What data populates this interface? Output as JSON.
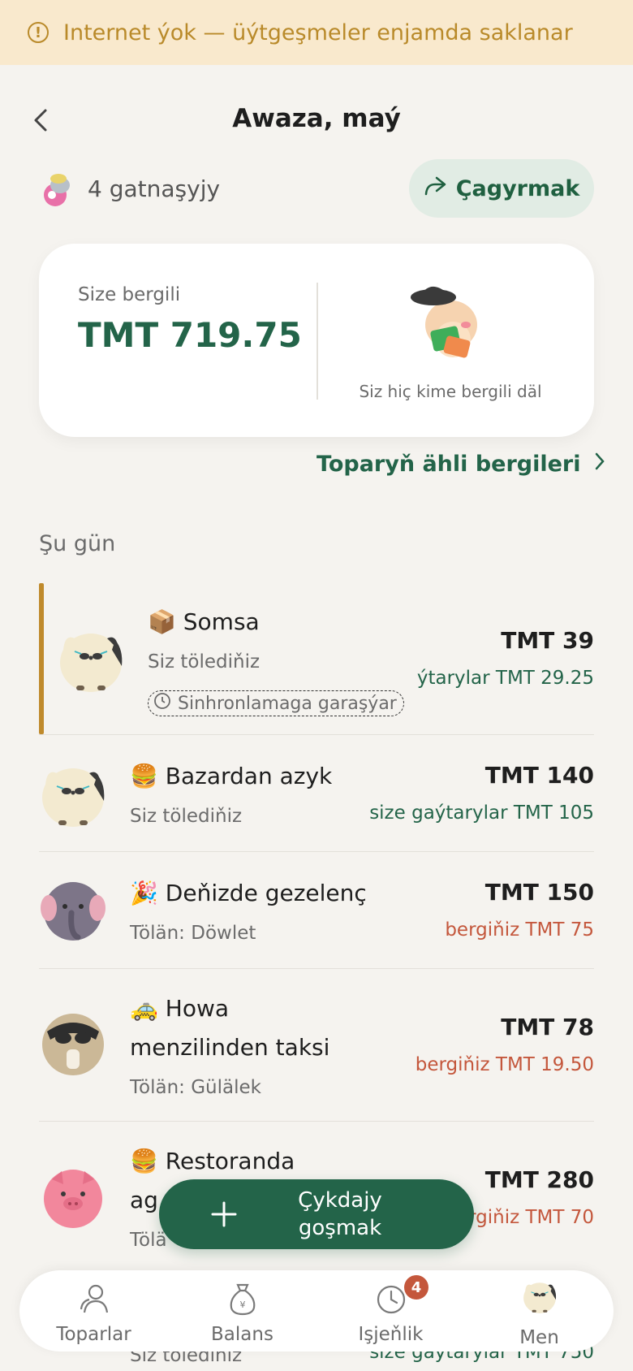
{
  "banner": {
    "text": "Internet ýok — üýtgeşmeler enjamda saklanar",
    "icon": "warning-circle-icon"
  },
  "header": {
    "title": "Awaza, maý"
  },
  "group": {
    "participants": "4 gatnaşyjy",
    "invite_label": "Çagyrmak"
  },
  "balance": {
    "owed_label": "Size bergili",
    "owed_amount": "TMT 719.75",
    "you_owe_text": "Siz hiç kime bergili däl"
  },
  "all_debts_link": "Toparyň ähli bergileri",
  "section_today": "Şu gün",
  "expenses": [
    {
      "emoji": "📦",
      "title": "Somsa",
      "sub": "Siz tölediňiz",
      "pending": "Sinhronlamaga garaşýar",
      "amount": "TMT 39",
      "note": "ýtarylar TMT 29.25",
      "avatar": "cat-avatar"
    },
    {
      "emoji": "🍔",
      "title": "Bazardan azyk",
      "sub": "Siz tölediňiz",
      "amount": "TMT 140",
      "note": "size gaýtarylar TMT 105",
      "avatar": "cat-avatar"
    },
    {
      "emoji": "🎉",
      "title": "Deňizde gezelenç",
      "sub": "Tölän: Döwlet",
      "amount": "TMT 150",
      "note": "bergiňiz TMT 75",
      "avatar": "elephant-avatar"
    },
    {
      "emoji": "🚕",
      "title_1": "Howa",
      "title_2": "menzilinden taksi",
      "sub": "Tölän: Gülälek",
      "amount": "TMT 78",
      "note": "bergiňiz TMT 19.50",
      "avatar": "raccoon-avatar"
    },
    {
      "emoji": "🍔",
      "title_1": "Restoranda",
      "title_2": "ag",
      "sub": "Tölä",
      "amount": "TMT 280",
      "note": "rgiňiz TMT 70",
      "avatar": "pig-avatar"
    },
    {
      "sub": "Siz tölediňiz",
      "note": "size gaýtarylar TMT 750"
    }
  ],
  "fab": {
    "label_1": "Çykdajy",
    "label_2": "goşmak"
  },
  "nav": [
    {
      "label": "Toparlar",
      "icon": "people-icon"
    },
    {
      "label": "Balans",
      "icon": "money-bag-icon"
    },
    {
      "label": "Işjeňlik",
      "icon": "clock-icon",
      "badge": "4"
    },
    {
      "label": "Men",
      "icon": "cat-avatar"
    }
  ],
  "colors": {
    "primary": "#236449",
    "accent_pending": "#bf8a2c",
    "negative": "#c4573c",
    "banner_bg": "#f9e9cd"
  }
}
